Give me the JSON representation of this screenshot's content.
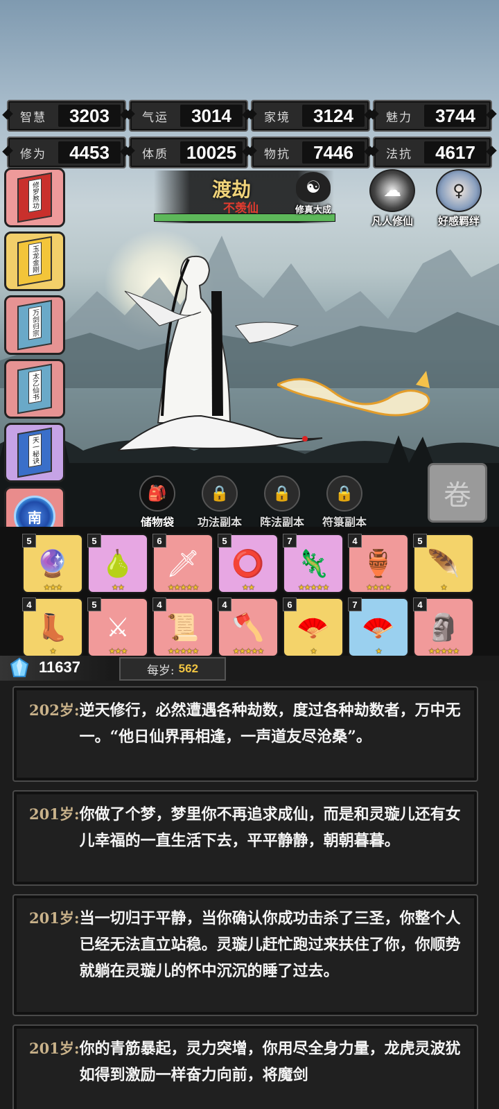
{
  "stats": [
    {
      "label": "智慧",
      "value": "3203"
    },
    {
      "label": "气运",
      "value": "3014"
    },
    {
      "label": "家境",
      "value": "3124"
    },
    {
      "label": "魅力",
      "value": "3744"
    },
    {
      "label": "修为",
      "value": "4453"
    },
    {
      "label": "体质",
      "value": "10025"
    },
    {
      "label": "物抗",
      "value": "7446"
    },
    {
      "label": "法抗",
      "value": "4617"
    }
  ],
  "books": [
    {
      "title": "修罗熬功",
      "color": "#ee9a9a"
    },
    {
      "title": "玉龙金刚",
      "color": "#f2cf6a"
    },
    {
      "title": "万剑归宗",
      "color": "#e69393"
    },
    {
      "title": "太乙仙书",
      "color": "#e69393"
    },
    {
      "title": "天一秘诀",
      "color": "#c6a3e6"
    }
  ],
  "compass_label": "南",
  "realm": {
    "title": "渡劫",
    "subtitle": "不羡仙",
    "progress": 1.0
  },
  "meditate_label": "修真大成",
  "mortal_label": "凡人修仙",
  "affinity_label": "好感羁绊",
  "tabs": [
    {
      "label": "储物袋",
      "icon": "bag-icon",
      "locked": false
    },
    {
      "label": "功法副本",
      "icon": "lock-icon",
      "locked": true
    },
    {
      "label": "阵法副本",
      "icon": "lock-icon",
      "locked": true
    },
    {
      "label": "符箓副本",
      "icon": "lock-icon",
      "locked": true
    }
  ],
  "items": [
    {
      "level": "5",
      "stars": 3,
      "bg": "y",
      "icon": "blue-orb-icon"
    },
    {
      "level": "5",
      "stars": 2,
      "bg": "p",
      "icon": "gourd-icon"
    },
    {
      "level": "6",
      "stars": 5,
      "bg": "r",
      "icon": "dagger-icon"
    },
    {
      "level": "5",
      "stars": 2,
      "bg": "p",
      "icon": "ring-icon"
    },
    {
      "level": "7",
      "stars": 5,
      "bg": "p",
      "icon": "jade-claw-icon"
    },
    {
      "level": "4",
      "stars": 4,
      "bg": "r",
      "icon": "censer-icon"
    },
    {
      "level": "5",
      "stars": 1,
      "bg": "y",
      "icon": "feather-icon"
    },
    {
      "level": "4",
      "stars": 1,
      "bg": "y",
      "icon": "boots-icon"
    },
    {
      "level": "5",
      "stars": 3,
      "bg": "r",
      "icon": "sword-icon"
    },
    {
      "level": "4",
      "stars": 5,
      "bg": "r",
      "icon": "scroll-icon"
    },
    {
      "level": "4",
      "stars": 5,
      "bg": "r",
      "icon": "axe-icon"
    },
    {
      "level": "6",
      "stars": 1,
      "bg": "y",
      "icon": "gold-fan-icon"
    },
    {
      "level": "7",
      "stars": 1,
      "bg": "b",
      "icon": "fan-icon"
    },
    {
      "level": "4",
      "stars": 5,
      "bg": "r",
      "icon": "jade-seal-icon"
    }
  ],
  "currency": {
    "value": "11637",
    "per_year_label": "每岁:",
    "per_year_value": "562"
  },
  "log": [
    {
      "age": "202岁:",
      "text": "逆天修行，必然遭遇各种劫数，度过各种劫数者，万中无一。“他日仙界再相逢，一声道友尽沧桑”。"
    },
    {
      "age": "201岁:",
      "text": "你做了个梦，梦里你不再追求成仙，而是和灵璇儿还有女儿幸福的一直生活下去，平平静静，朝朝暮暮。"
    },
    {
      "age": "201岁:",
      "text": "当一切归于平静，当你确认你成功击杀了三圣，你整个人已经无法直立站稳。灵璇儿赶忙跑过来扶住了你，你顺势就躺在灵璇儿的怀中沉沉的睡了过去。"
    },
    {
      "age": "201岁:",
      "text": "你的青筋暴起，灵力突增，你用尽全身力量，龙虎灵波犹如得到激励一样奋力向前，将魔剑"
    }
  ]
}
